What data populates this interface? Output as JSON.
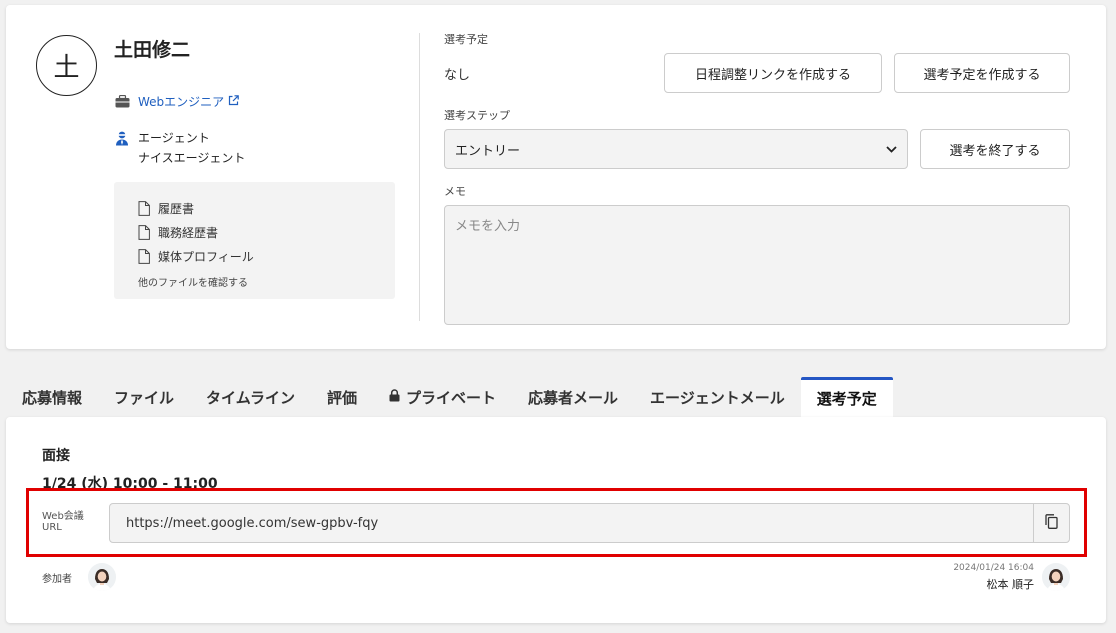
{
  "candidate": {
    "initial": "土",
    "name": "土田修二",
    "job_title": "Webエンジニア",
    "source_type": "エージェント",
    "source_name": "ナイスエージェント"
  },
  "files": {
    "items": [
      "履歴書",
      "職務経歴書",
      "媒体プロフィール"
    ],
    "more_link": "他のファイルを確認する"
  },
  "selection": {
    "schedule_label": "選考予定",
    "schedule_value": "なし",
    "link_button": "日程調整リンクを作成する",
    "create_button": "選考予定を作成する",
    "step_label": "選考ステップ",
    "step_value": "エントリー",
    "end_button": "選考を終了する",
    "memo_label": "メモ",
    "memo_placeholder": "メモを入力"
  },
  "tabs": [
    {
      "label": "応募情報",
      "active": false
    },
    {
      "label": "ファイル",
      "active": false
    },
    {
      "label": "タイムライン",
      "active": false
    },
    {
      "label": "評価",
      "active": false
    },
    {
      "label": "プライベート",
      "active": false,
      "icon": "lock-icon"
    },
    {
      "label": "応募者メール",
      "active": false
    },
    {
      "label": "エージェントメール",
      "active": false
    },
    {
      "label": "選考予定",
      "active": true
    }
  ],
  "schedule": {
    "title": "面接",
    "datetime": "1/24 (水) 10:00 - 11:00",
    "url_label_line1": "Web会議",
    "url_label_line2": "URL",
    "url": "https://meet.google.com/sew-gpbv-fqy",
    "participants_label": "参加者",
    "updated_at": "2024/01/24 16:04",
    "updated_by": "松本 順子"
  },
  "colors": {
    "accent": "#2456c4",
    "link": "#1f5fbf",
    "highlight": "#e00000"
  }
}
